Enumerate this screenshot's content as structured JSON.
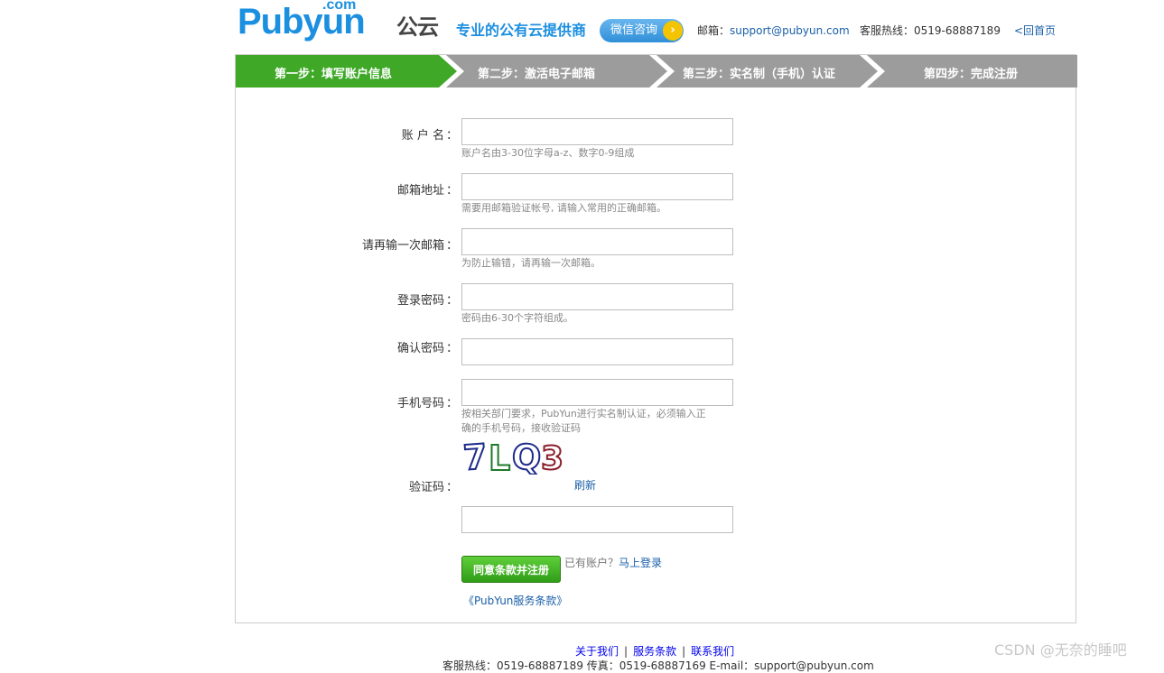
{
  "header": {
    "logo_en": "Pubyun",
    "logo_domain": ".com",
    "logo_cn": "公云",
    "slogan": "专业的公有云提供商",
    "wechat_button": "微信咨询",
    "email_label": "邮箱：",
    "email_value": "support@pubyun.com",
    "hotline": "客服热线：0519-68887189",
    "home_link": "<回首页"
  },
  "steps": [
    {
      "label": "第一步：填写账户信息",
      "active": true
    },
    {
      "label": "第二步：激活电子邮箱",
      "active": false
    },
    {
      "label": "第三步：实名制（手机）认证",
      "active": false
    },
    {
      "label": "第四步：完成注册",
      "active": false
    }
  ],
  "colors": {
    "step_active": "#3fa827",
    "step_inactive": "#9c9c9c",
    "brand_blue": "#1b8fe0",
    "link_blue": "#1a5fa8",
    "button_green": "#3fae22"
  },
  "form": {
    "account": {
      "label": "账 户 名",
      "value": "",
      "hint": "账户名由3-30位字母a-z、数字0-9组成"
    },
    "email": {
      "label": "邮箱地址",
      "value": "",
      "hint": "需要用邮箱验证帐号, 请输入常用的正确邮箱。"
    },
    "email_confirm": {
      "label": "请再输一次邮箱",
      "value": "",
      "hint": "为防止输错，请再输一次邮箱。"
    },
    "password": {
      "label": "登录密码",
      "value": "",
      "hint": "密码由6-30个字符组成。"
    },
    "password_confirm": {
      "label": "确认密码",
      "value": ""
    },
    "phone": {
      "label": "手机号码",
      "value": "",
      "hint_line1": "按相关部门要求，PubYun进行实名制认证，必须输入正",
      "hint_line2": "确的手机号码，接收验证码"
    },
    "captcha": {
      "label": "验证码",
      "image_text": "7LQ3",
      "refresh": "刷新",
      "value": ""
    },
    "colon": "：",
    "submit": "同意条款并注册",
    "have_account": "已有账户？",
    "login_link": "马上登录",
    "terms_link": "《PubYun服务条款》"
  },
  "footer": {
    "links": [
      "关于我们",
      "服务条款",
      "联系我们"
    ],
    "separator": "|",
    "info": "客服热线：0519-68887189   传真：0519-68887169   E-mail：support@pubyun.com"
  },
  "watermark": "CSDN @无奈的睡吧"
}
